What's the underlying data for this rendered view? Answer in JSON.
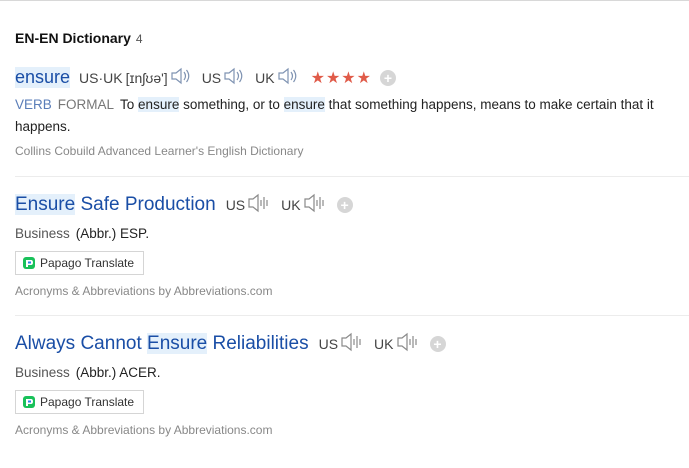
{
  "section": {
    "title": "EN-EN Dictionary",
    "count": "4"
  },
  "entry1": {
    "word": "ensure",
    "us_uk_label": "US·UK",
    "phonetic": "[ɪnʃʊə']",
    "us_label": "US",
    "uk_label": "UK",
    "stars": "★★★★",
    "plus": "+",
    "pos": "VERB",
    "register": "FORMAL",
    "def_part1": "To ",
    "def_hl1": "ensure",
    "def_part2": " something, or to ",
    "def_hl2": "ensure",
    "def_part3": " that something happens, means to make certain that it happens.",
    "source": "Collins Cobuild Advanced Learner's English Dictionary"
  },
  "entry2": {
    "word_hl": "Ensure",
    "word_rest": " Safe Production",
    "us_label": "US",
    "uk_label": "UK",
    "plus": "+",
    "category": "Business",
    "abbr": "(Abbr.) ESP.",
    "papago": "Papago Translate",
    "source": "Acronyms & Abbreviations by Abbreviations.com"
  },
  "entry3": {
    "word_pre": "Always Cannot ",
    "word_hl": "Ensure",
    "word_rest": " Reliabilities",
    "us_label": "US",
    "uk_label": "UK",
    "plus": "+",
    "category": "Business",
    "abbr": "(Abbr.) ACER.",
    "papago": "Papago Translate",
    "source": "Acronyms & Abbreviations by Abbreviations.com"
  }
}
